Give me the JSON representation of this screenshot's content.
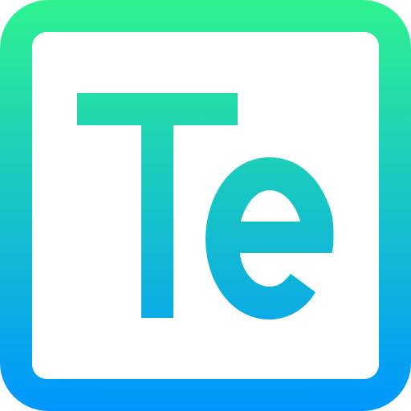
{
  "icon": {
    "name": "tellurium-element-icon",
    "symbol": "Te",
    "gradient": {
      "top_color": "#2EF28F",
      "bottom_color": "#0096FF"
    },
    "inner_background": "#FFFFFF"
  }
}
